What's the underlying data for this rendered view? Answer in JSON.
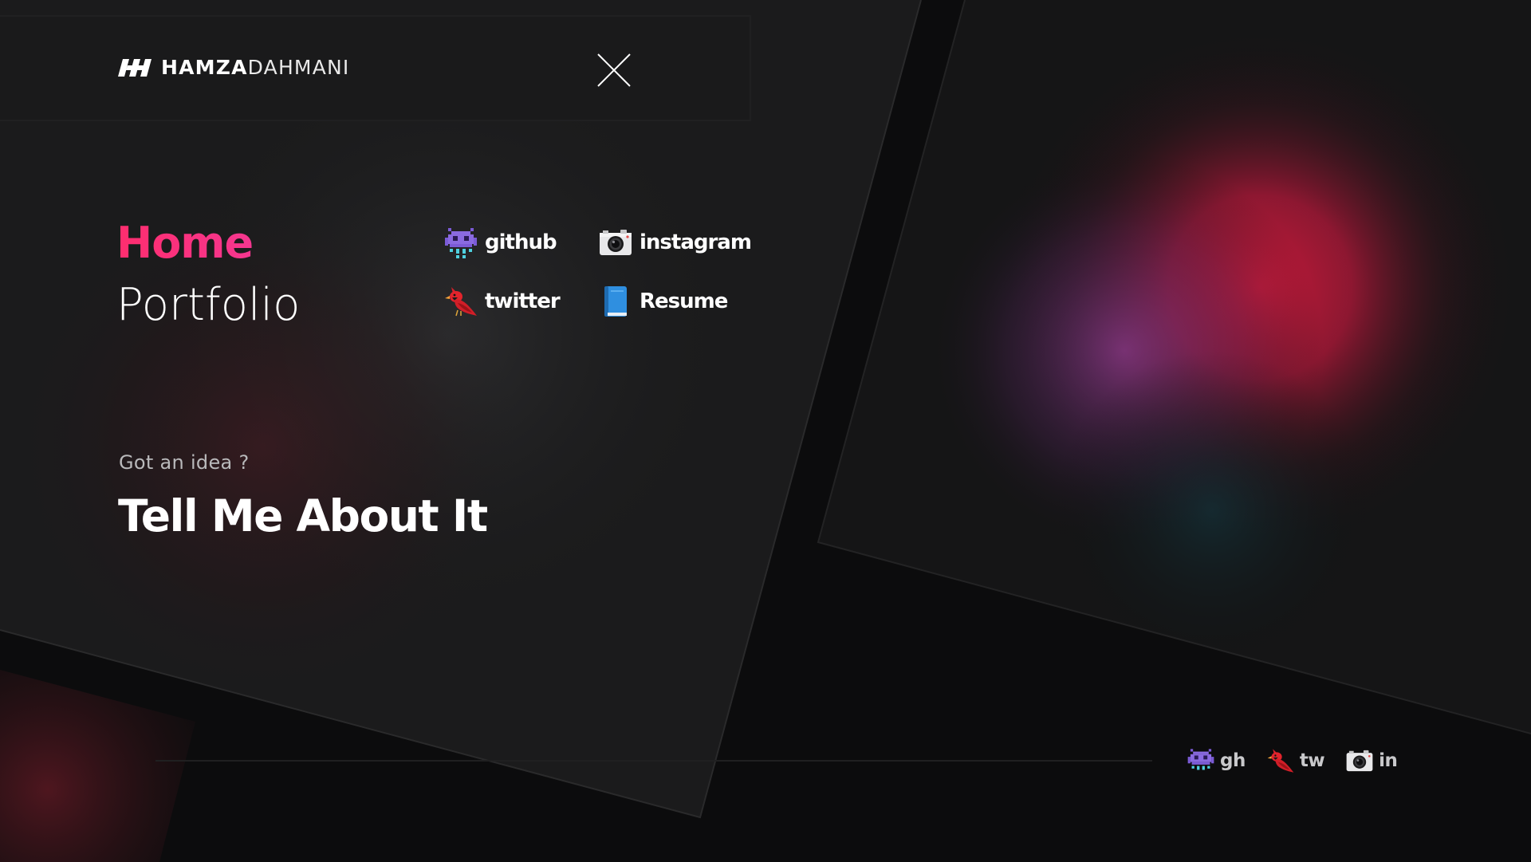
{
  "brand": {
    "first": "HAMZA",
    "last": "DAHMANI",
    "mark_icon": "slanted-bars-logo-icon"
  },
  "header": {
    "close_icon": "close-icon"
  },
  "nav": {
    "items": [
      {
        "label": "Home",
        "active": true
      },
      {
        "label": "Portfolio",
        "active": false
      }
    ]
  },
  "socials": {
    "items": [
      {
        "label": "github",
        "icon": "space-invader-icon"
      },
      {
        "label": "instagram",
        "icon": "camera-icon"
      },
      {
        "label": "twitter",
        "icon": "cardinal-bird-icon"
      },
      {
        "label": "Resume",
        "icon": "blue-book-icon"
      }
    ]
  },
  "contact": {
    "kicker": "Got an idea ?",
    "cta": "Tell Me About It"
  },
  "footer": {
    "socials": [
      {
        "label": "gh",
        "icon": "space-invader-icon"
      },
      {
        "label": "tw",
        "icon": "cardinal-bird-icon"
      },
      {
        "label": "in",
        "icon": "camera-icon"
      }
    ]
  },
  "colors": {
    "background": "#0c0c0d",
    "panel": "#1a1a1b",
    "accent_pink": "#ff2d6e",
    "accent_magenta": "#f13a9b",
    "glow_red": "#d21a3c",
    "glow_purple": "#7a3a8a",
    "text_muted": "#b9b9bb"
  }
}
